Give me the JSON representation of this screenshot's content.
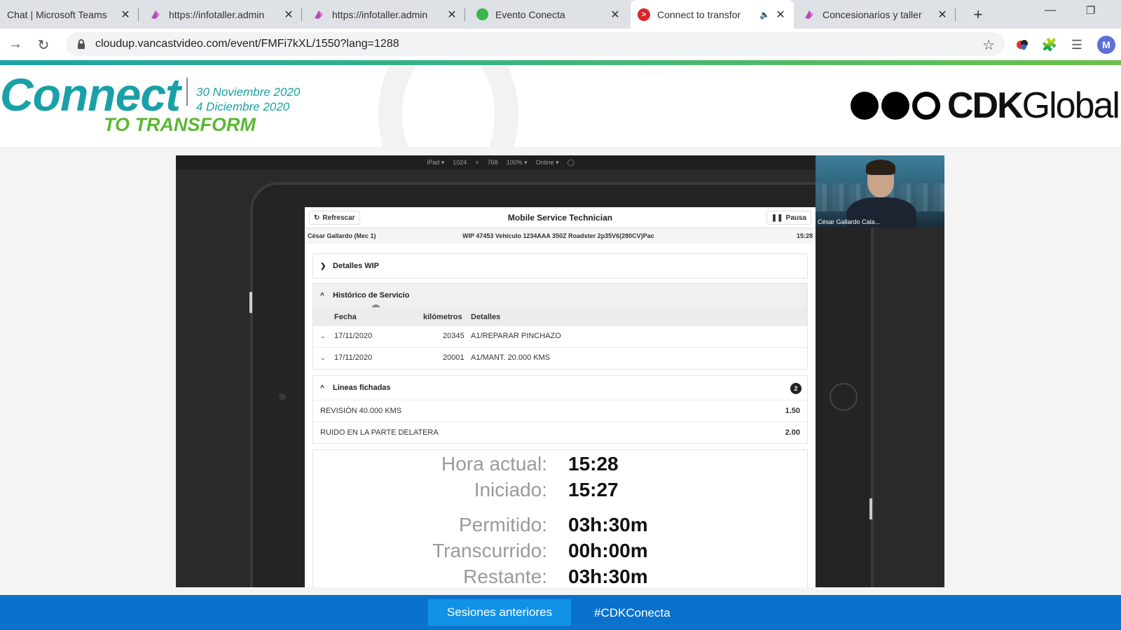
{
  "browser": {
    "tabs": [
      {
        "title": "Chat | Microsoft Teams",
        "icon": "teams-icon"
      },
      {
        "title": "https://infotaller.admin",
        "icon": "purple-app-icon"
      },
      {
        "title": "https://infotaller.admin",
        "icon": "purple-app-icon"
      },
      {
        "title": "Evento Conecta",
        "icon": "green-circle-icon"
      },
      {
        "title": "Connect to transfor",
        "icon": "red-play-icon",
        "active": true,
        "audio": true
      },
      {
        "title": "Concesionarios y taller",
        "icon": "purple-app-icon"
      }
    ],
    "close_glyph": "✕",
    "new_tab_glyph": "+",
    "url": "cloudup.vancastvideo.com/event/FMFi7kXL/1550?lang=1288",
    "profile_initial": "M"
  },
  "header": {
    "logo_word": "Connect",
    "date1": "30 Noviembre 2020",
    "date2": "4 Diciembre 2020",
    "logo_tagline": "TO TRANSFORM",
    "brand_a": "CDK",
    "brand_b": "Global.",
    "colors": {
      "teal": "#1aa0a8",
      "green": "#5bb833"
    }
  },
  "video": {
    "devtools": {
      "device": "iPad ▾",
      "width": "1024",
      "times": "×",
      "height": "768",
      "zoom": "100% ▾",
      "network": "Online ▾"
    },
    "webcam_name": "César Gallardo Cala...",
    "app": {
      "refresh_label": "Refrescar",
      "title": "Mobile Service Technician",
      "pause_label": "Pausa",
      "technician": "César Gallardo (Mec 1)",
      "wip": "WIP 47453 Vehiculo 1234AAA 350Z Roadster 2p35V6(280CV)Pac",
      "time": "15:28",
      "sections": {
        "wip_details": "Detalles WIP",
        "history": "Histórico de Servicio",
        "lines": "Lineas fichadas"
      },
      "history_table": {
        "headers": [
          "Fecha",
          "kilómetros",
          "Detalles"
        ],
        "rows": [
          {
            "date": "17/11/2020",
            "km": "20345",
            "details": "A1/REPARAR PINCHAZO"
          },
          {
            "date": "17/11/2020",
            "km": "20001",
            "details": "A1/MANT. 20.000 KMS"
          }
        ]
      },
      "lines_count": "2",
      "lines": [
        {
          "label": "REVISIÓN 40.000 KMS",
          "value": "1.50"
        },
        {
          "label": "RUIDO EN LA PARTE DELATERA",
          "value": "2.00"
        }
      ],
      "timer": [
        {
          "label": "Hora actual:",
          "value": "15:28"
        },
        {
          "label": "Iniciado:",
          "value": "15:27"
        },
        {
          "label": "Permitido:",
          "value": "03h:30m"
        },
        {
          "label": "Transcurrido:",
          "value": "00h:00m"
        },
        {
          "label": "Restante:",
          "value": "03h:30m"
        }
      ]
    }
  },
  "footer": {
    "button_label": "Sesiones anteriores",
    "hashtag": "#CDKConecta"
  }
}
